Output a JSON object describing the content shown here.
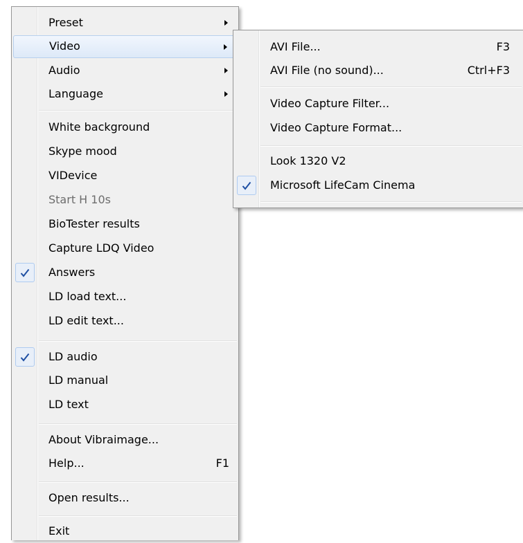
{
  "main_menu": {
    "preset": "Preset",
    "video": "Video",
    "audio": "Audio",
    "language": "Language",
    "white_background": "White background",
    "skype_mood": "Skype mood",
    "videvice": "VIDevice",
    "start_h10s": "Start H 10s",
    "biotester_results": "BioTester results",
    "capture_ldq_video": "Capture LDQ Video",
    "answers": "Answers",
    "ld_load_text": "LD load text...",
    "ld_edit_text": "LD edit text...",
    "ld_audio": "LD audio",
    "ld_manual": "LD manual",
    "ld_text": "LD text",
    "about": "About Vibraimage...",
    "help": "Help...",
    "help_shortcut": "F1",
    "open_results": "Open results...",
    "exit": "Exit"
  },
  "video_submenu": {
    "avi_file": "AVI File...",
    "avi_file_shortcut": "F3",
    "avi_file_no_sound": "AVI File (no sound)...",
    "avi_file_no_sound_shortcut": "Ctrl+F3",
    "video_capture_filter": "Video Capture Filter...",
    "video_capture_format": "Video Capture Format...",
    "look_1320_v2": "Look 1320 V2",
    "microsoft_lifecam_cinema": "Microsoft LifeCam Cinema"
  },
  "state": {
    "checked_items": [
      "Answers",
      "LD audio",
      "Microsoft LifeCam Cinema"
    ],
    "disabled_items": [
      "Start H 10s"
    ],
    "highlighted_item": "Video"
  },
  "colors": {
    "menu_background": "#f0f0f0",
    "hover_background": "#dde9f8",
    "check_background": "#e8eff9",
    "check_mark": "#1e4fa3",
    "disabled_text": "#6d6d6d"
  }
}
